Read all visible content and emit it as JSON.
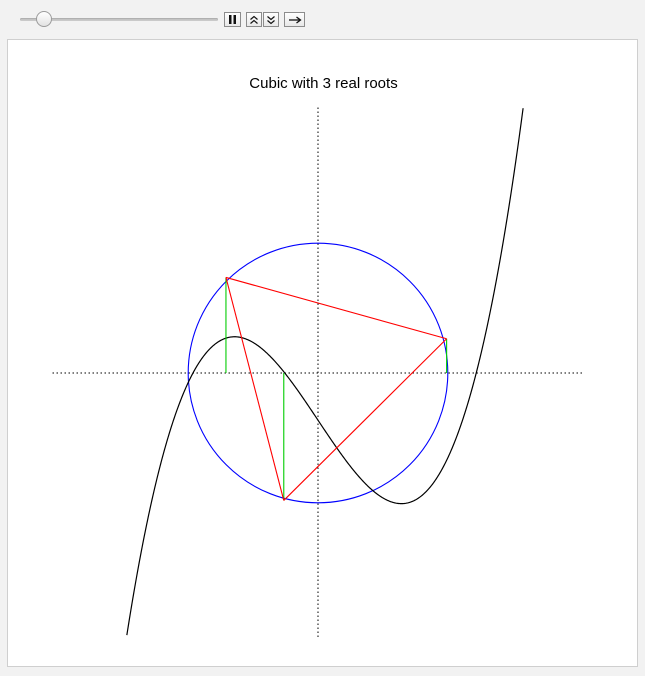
{
  "title": "Cubic with 3 real roots",
  "animation": {
    "slider_fraction": 0.12
  },
  "icons": {
    "pause": "pause-icon",
    "faster": "double-chevron-up-icon",
    "slower": "double-chevron-down-icon",
    "direction": "right-arrow-icon"
  },
  "colors": {
    "curve": "#000000",
    "circle": "#0000ff",
    "triangle": "#ff0000",
    "verticals": "#00cc00",
    "axes": "#000000"
  },
  "chart_data": {
    "type": "line",
    "title": "Cubic with 3 real roots",
    "xlim": [
      -2.25,
      2.25
    ],
    "ylim": [
      -2.25,
      2.25
    ],
    "axes": {
      "style": "dotted",
      "ticks": false
    },
    "cubic": {
      "coefficients": [
        1,
        0,
        -1.5,
        -0.4
      ],
      "form": "x^3 - 1.5x - 0.4"
    },
    "circle": {
      "center": [
        0,
        0
      ],
      "radius": 1.1
    },
    "triangle_vertices": [
      [
        -0.78,
        0.81
      ],
      [
        1.09,
        0.29
      ],
      [
        -0.29,
        -1.08
      ]
    ],
    "real_roots": [
      -1.09,
      -0.29,
      1.38
    ]
  }
}
